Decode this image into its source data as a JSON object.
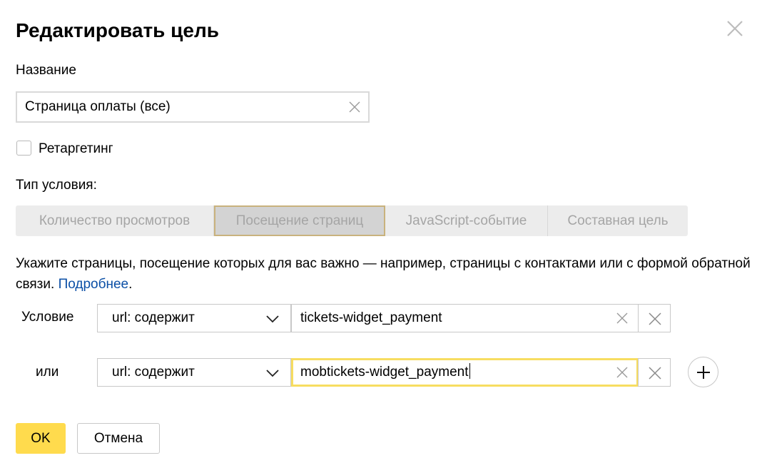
{
  "dialog": {
    "title": "Редактировать цель",
    "close_icon": "close-icon"
  },
  "name_field": {
    "label": "Название",
    "value": "Страница оплаты (все)",
    "clear_icon": "clear-icon"
  },
  "retargeting": {
    "label": "Ретаргетинг",
    "checked": false
  },
  "condition_type": {
    "label": "Тип условия:",
    "options": [
      {
        "label": "Количество просмотров",
        "active": false
      },
      {
        "label": "Посещение страниц",
        "active": true
      },
      {
        "label": "JavaScript-событие",
        "active": false
      },
      {
        "label": "Составная цель",
        "active": false
      }
    ]
  },
  "description": {
    "text": "Укажите страницы, посещение которых для вас важно — например, страницы с контактами или с формой обратной связи.",
    "link": "Подробнее",
    "tail": "."
  },
  "conditions": [
    {
      "label": "Условие",
      "match": "url: содержит",
      "value": "tickets-widget_payment",
      "focused": false
    },
    {
      "label": "или",
      "match": "url: содержит",
      "value": "mobtickets-widget_payment",
      "focused": true
    }
  ],
  "add_icon": "plus-icon",
  "buttons": {
    "ok": "OK",
    "cancel": "Отмена"
  },
  "colors": {
    "accent_yellow": "#ffdb4d",
    "focus_border": "#f7dd61",
    "link": "#0b4fa6",
    "segment_bg": "#ececec",
    "segment_active_bg": "#d3d3d3"
  }
}
